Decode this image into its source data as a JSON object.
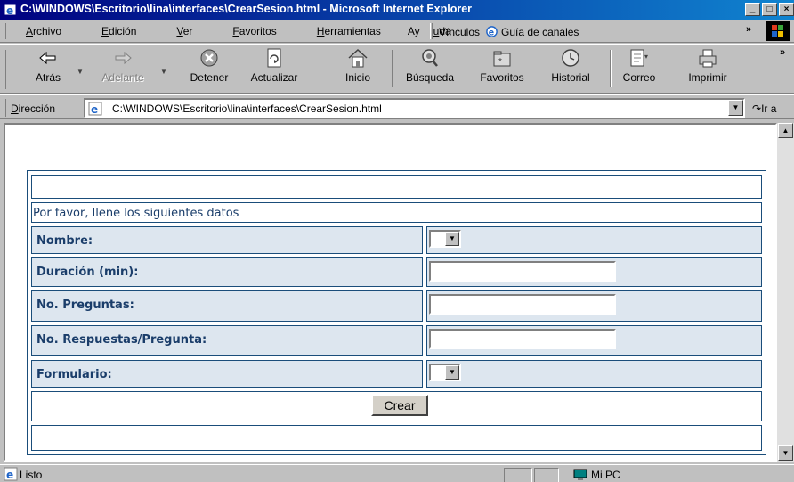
{
  "window": {
    "title": "C:\\WINDOWS\\Escritorio\\lina\\interfaces\\CrearSesion.html - Microsoft Internet Explorer",
    "controls": [
      "_",
      "□",
      "×"
    ]
  },
  "menubar": {
    "items": [
      {
        "pre": "",
        "key": "A",
        "post": "rchivo"
      },
      {
        "pre": "",
        "key": "E",
        "post": "dición"
      },
      {
        "pre": "",
        "key": "V",
        "post": "er"
      },
      {
        "pre": "",
        "key": "F",
        "post": "avoritos"
      },
      {
        "pre": "",
        "key": "H",
        "post": "erramientas"
      },
      {
        "pre": "Ay",
        "key": "u",
        "post": "da"
      }
    ],
    "links_label": "Vínculos",
    "links_item": "Guía de canales",
    "more": "»"
  },
  "toolbar": {
    "back": "Atrás",
    "forward": "Adelante",
    "stop": "Detener",
    "refresh": "Actualizar",
    "home": "Inicio",
    "search": "Búsqueda",
    "favorites": "Favoritos",
    "history": "Historial",
    "mail": "Correo",
    "print": "Imprimir",
    "more": "»"
  },
  "addressbar": {
    "label_key": "D",
    "label_rest": "irección",
    "url": "C:\\WINDOWS\\Escritorio\\lina\\interfaces\\CrearSesion.html",
    "go": "Ir a"
  },
  "form": {
    "header": "",
    "hint": "Por favor, llene los siguientes datos",
    "fields": {
      "nombre": "Nombre:",
      "duracion": "Duración (min):",
      "preguntas": "No. Preguntas:",
      "respuestas": "No. Respuestas/Pregunta:",
      "formulario": "Formulario:"
    },
    "values": {
      "nombre": "",
      "duracion": "",
      "preguntas": "",
      "respuestas": "",
      "formulario": ""
    },
    "submit": "Crear",
    "footer": ""
  },
  "statusbar": {
    "text": "Listo",
    "zone": "Mi PC"
  },
  "colors": {
    "title_gradient_start": "#000080",
    "title_gradient_end": "#1084d0",
    "form_border": "#1a4d7a",
    "label_bg": "#dde6ef",
    "label_text": "#1a3d6a"
  }
}
